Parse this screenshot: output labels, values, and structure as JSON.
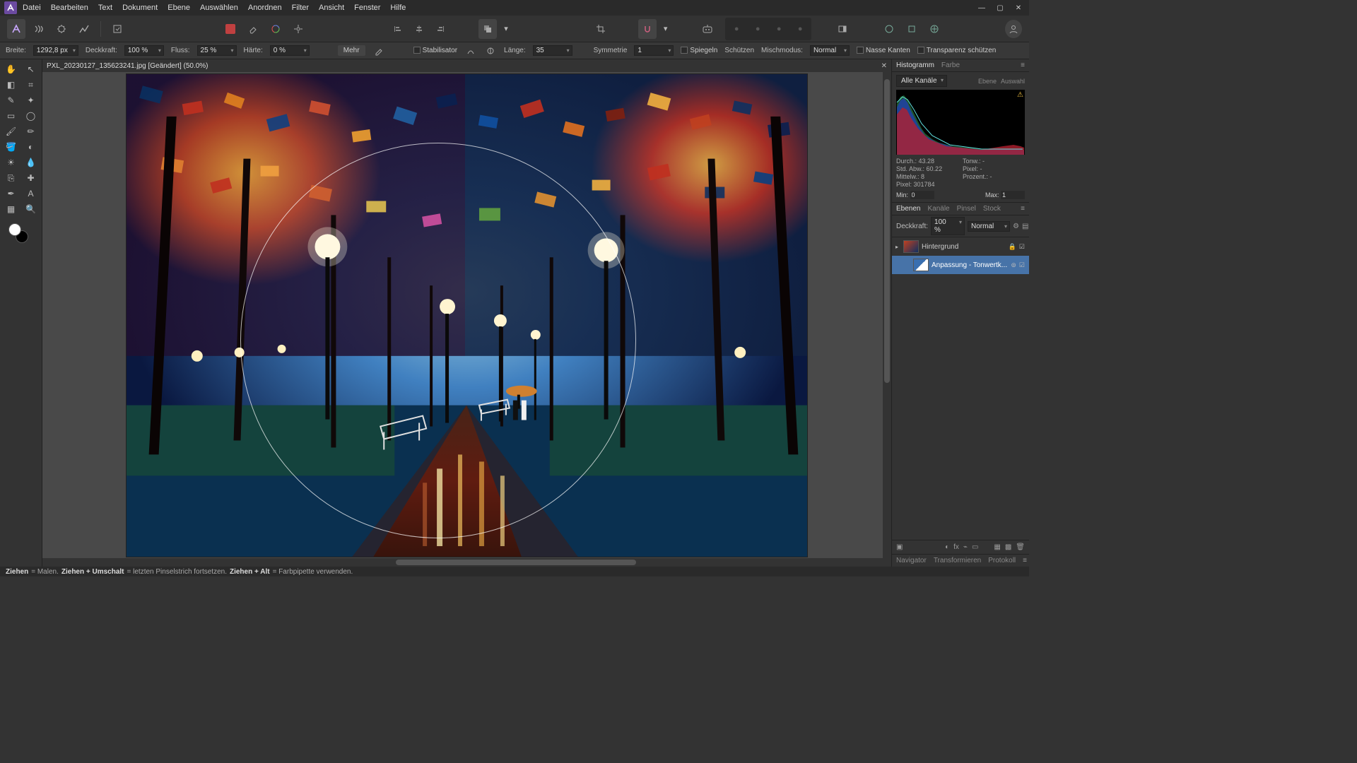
{
  "menu": [
    "Datei",
    "Bearbeiten",
    "Text",
    "Dokument",
    "Ebene",
    "Auswählen",
    "Anordnen",
    "Filter",
    "Ansicht",
    "Fenster",
    "Hilfe"
  ],
  "context": {
    "width_label": "Breite:",
    "width_value": "1292,8 px",
    "opacity_label": "Deckkraft:",
    "opacity_value": "100 %",
    "flow_label": "Fluss:",
    "flow_value": "25 %",
    "hardness_label": "Härte:",
    "hardness_value": "0 %",
    "more": "Mehr",
    "stabilizer": "Stabilisator",
    "length_label": "Länge:",
    "length_value": "35",
    "symmetry_label": "Symmetrie",
    "symmetry_value": "1",
    "mirror": "Spiegeln",
    "protect": "Schützen",
    "blendmode_label": "Mischmodus:",
    "blendmode_value": "Normal",
    "wet_edges": "Nasse Kanten",
    "protect_alpha": "Transparenz schützen"
  },
  "file_tab": "PXL_20230127_135623241.jpg [Geändert] (50.0%)",
  "hist_tabs": [
    "Histogramm",
    "Farbe"
  ],
  "hist_channel": "Alle Kanäle",
  "hist_buttons": [
    "Ebene",
    "Auswahl"
  ],
  "hist_stats": {
    "mean_l": "Durch.:",
    "mean_v": "43.28",
    "std_l": "Std. Abw.:",
    "std_v": "60.22",
    "med_l": "Mittelw.:",
    "med_v": "8",
    "px_l": "Pixel:",
    "px_v": "301784",
    "tone_l": "Tonw.:",
    "tone_v": "-",
    "pxr_l": "Pixel:",
    "pxr_v": "-",
    "pct_l": "Prozent.:",
    "pct_v": "-"
  },
  "hist_min_label": "Min:",
  "hist_min": "0",
  "hist_max_label": "Max:",
  "hist_max": "1",
  "layer_tabs": [
    "Ebenen",
    "Kanäle",
    "Pinsel",
    "Stock"
  ],
  "layer_opacity_label": "Deckkraft:",
  "layer_opacity": "100 %",
  "layer_blend": "Normal",
  "layers": [
    {
      "name": "Hintergrund"
    },
    {
      "name": "Anpassung - Tonwertk..."
    }
  ],
  "bottom_tabs": [
    "Navigator",
    "Transformieren",
    "Protokoll"
  ],
  "status": {
    "s1": "Ziehen",
    "d1": "= Malen.",
    "s2": "Ziehen + Umschalt",
    "d2": "= letzten Pinselstrich fortsetzen.",
    "s3": "Ziehen + Alt",
    "d3": "= Farbpipette verwenden."
  }
}
